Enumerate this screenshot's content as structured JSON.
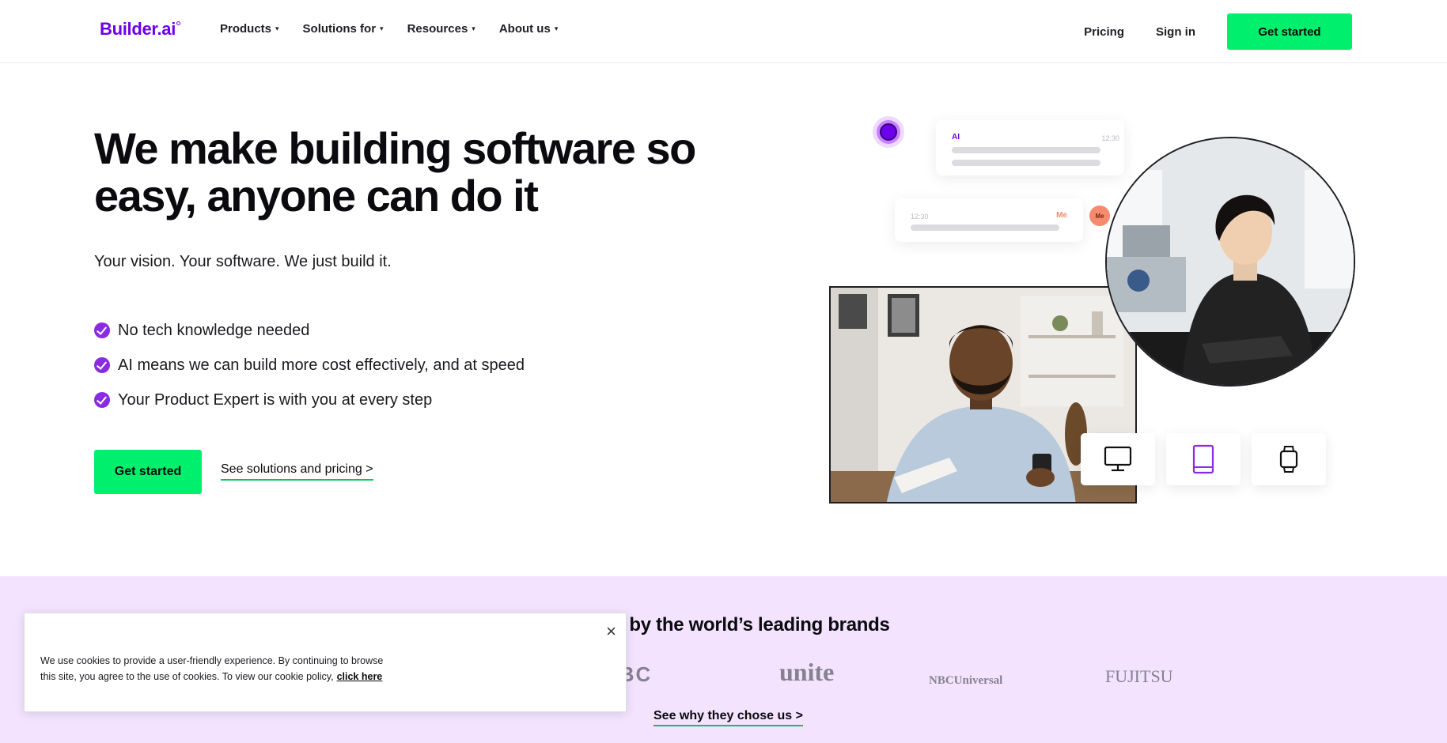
{
  "header": {
    "logo_text": "Builder.ai",
    "nav": [
      {
        "label": "Products"
      },
      {
        "label": "Solutions for"
      },
      {
        "label": "Resources"
      },
      {
        "label": "About us"
      }
    ],
    "pricing_label": "Pricing",
    "signin_label": "Sign in",
    "cta_label": "Get started"
  },
  "hero": {
    "title": "We make building software so easy, anyone can do it",
    "subtitle": "Your vision. Your software. We just build it.",
    "features": [
      "No tech knowledge needed",
      "AI means we can build more cost effectively, and at speed",
      "Your Product Expert is with you at every step"
    ],
    "cta_label": "Get started",
    "solutions_link": "See solutions and pricing >"
  },
  "illustration": {
    "ai_label": "AI",
    "ai_time": "12:30",
    "me_label": "Me",
    "me_time": "12:30",
    "avatar_label": "Me",
    "devices": [
      "desktop-icon",
      "tablet-icon",
      "watch-icon"
    ]
  },
  "brands": {
    "title": "Trusted by the world’s leading brands",
    "logos": [
      "BBC",
      "unite",
      "NBCUniversal",
      "FUJITSU"
    ],
    "see_why": "See why they chose us >"
  },
  "cookie": {
    "text": "We use cookies to provide a user-friendly experience. By continuing to browse this site, you agree to the use of cookies. To view our cookie policy,",
    "link_label": "click here",
    "close_label": "×"
  },
  "colors": {
    "brand": "#6c00ea",
    "cta": "#00f06d",
    "band": "#f3e3ff"
  }
}
